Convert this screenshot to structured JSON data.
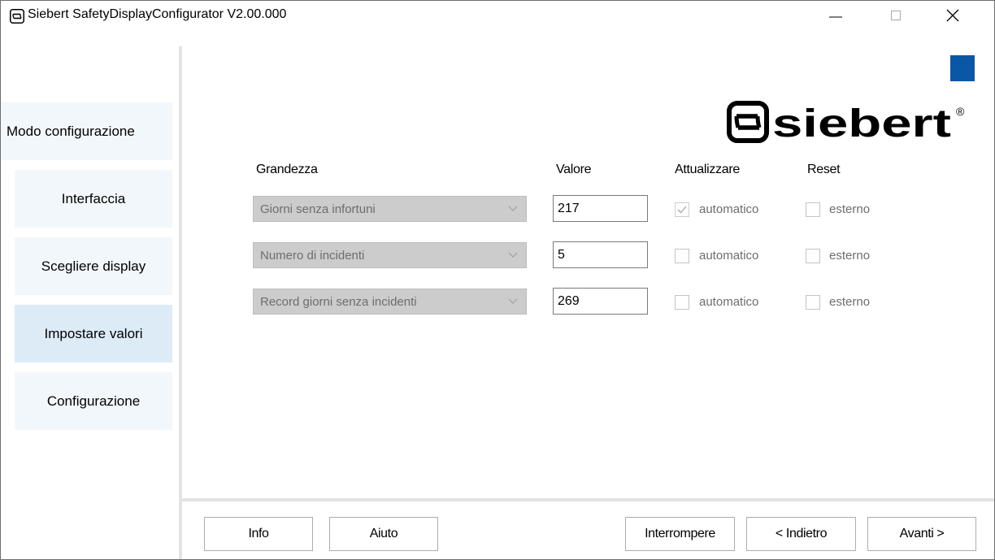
{
  "window": {
    "title": "Siebert SafetyDisplayConfigurator V2.00.000",
    "icon": "siebert-app-icon",
    "controls": [
      "minimize-icon",
      "maximize-icon",
      "close-icon"
    ]
  },
  "colors": {
    "accent": "#0a57a6",
    "sidebar_bg": "#f2f7fb",
    "sidebar_active": "#ddebf7",
    "disabled_combo": "#cccccc"
  },
  "sidebar": {
    "items": [
      {
        "label": "Modo configurazione",
        "active": false
      },
      {
        "label": "Interfaccia",
        "active": false
      },
      {
        "label": "Scegliere display",
        "active": false
      },
      {
        "label": "Impostare valori",
        "active": true
      },
      {
        "label": "Configurazione",
        "active": false
      }
    ]
  },
  "logo": {
    "text": "siebert",
    "mark": "®"
  },
  "table": {
    "headers": {
      "quantity": "Grandezza",
      "value": "Valore",
      "update": "Attualizzare",
      "reset": "Reset"
    },
    "rows": [
      {
        "quantity": "Giorni senza infortuni",
        "value": "217",
        "auto_label": "automatico",
        "auto_checked": true,
        "ext_label": "esterno",
        "ext_checked": false
      },
      {
        "quantity": "Numero di incidenti",
        "value": "5",
        "auto_label": "automatico",
        "auto_checked": false,
        "ext_label": "esterno",
        "ext_checked": false
      },
      {
        "quantity": "Record giorni senza incidenti",
        "value": "269",
        "auto_label": "automatico",
        "auto_checked": false,
        "ext_label": "esterno",
        "ext_checked": false
      }
    ]
  },
  "footer": {
    "info": "Info",
    "help": "Aiuto",
    "cancel": "Interrompere",
    "back": "< Indietro",
    "next": "Avanti >"
  }
}
